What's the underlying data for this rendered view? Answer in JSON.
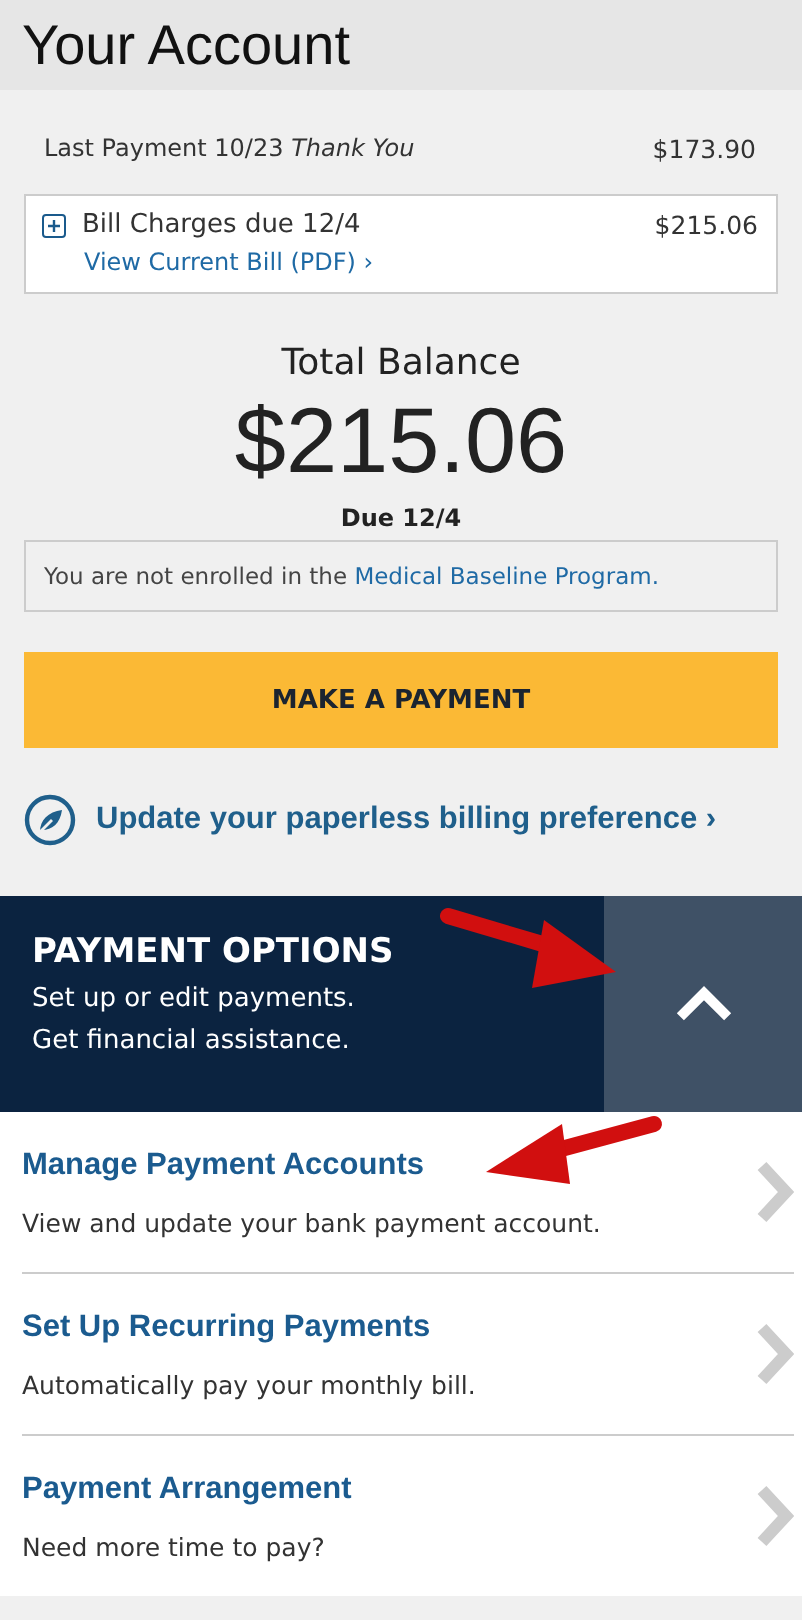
{
  "header": {
    "title": "Your Account"
  },
  "last_payment": {
    "label": "Last Payment 10/23 *Thank You*",
    "amount": "$173.90"
  },
  "bill_charges": {
    "label": "Bill Charges due 12/4",
    "amount": "$215.06",
    "link": "View Current Bill (PDF)",
    "link_arrow": "›",
    "expanded": false
  },
  "balance": {
    "label": "Total Balance",
    "amount": "$215.06",
    "due": "Due 12/4"
  },
  "notice": {
    "text": "You are not enrolled in the",
    "link": "Medical Baseline Program."
  },
  "pay_button": "MAKE A PAYMENT",
  "paperless_link": {
    "text": "Update your paperless billing preference",
    "arrow": "›"
  },
  "payment_options": {
    "title": "PAYMENT OPTIONS",
    "lines": [
      "Set up or edit payments.",
      "Get financial assistance."
    ],
    "expanded": true,
    "items": [
      {
        "title": "Manage Payment Accounts",
        "description": "View and update your bank payment account."
      },
      {
        "title": "Set Up Recurring Payments",
        "description": "Automatically pay your monthly bill."
      },
      {
        "title": "Payment Arrangement",
        "description": "Need more time to pay?"
      }
    ]
  }
}
